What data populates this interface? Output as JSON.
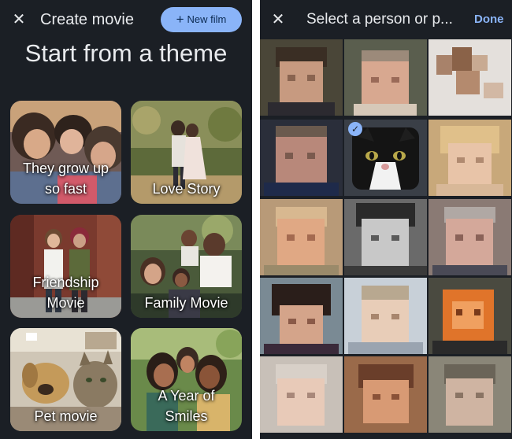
{
  "left": {
    "title": "Create movie",
    "new_film_label": "New film",
    "heading": "Start from a theme",
    "themes": [
      {
        "line1": "They grow up",
        "line2": "so fast"
      },
      {
        "line1": "Love Story",
        "line2": ""
      },
      {
        "line1": "Friendship",
        "line2": "Movie"
      },
      {
        "line1": "Family Movie",
        "line2": ""
      },
      {
        "line1": "Pet movie",
        "line2": ""
      },
      {
        "line1": "A Year of",
        "line2": "Smiles"
      }
    ]
  },
  "right": {
    "title": "Select a person or p...",
    "done_label": "Done",
    "selected_index": 4
  },
  "colors": {
    "background": "#1b1f25",
    "accent": "#8ab4f8",
    "text": "#e8eaed"
  },
  "icons": {
    "close": "close-icon",
    "add": "plus-icon",
    "selected": "check-icon"
  }
}
